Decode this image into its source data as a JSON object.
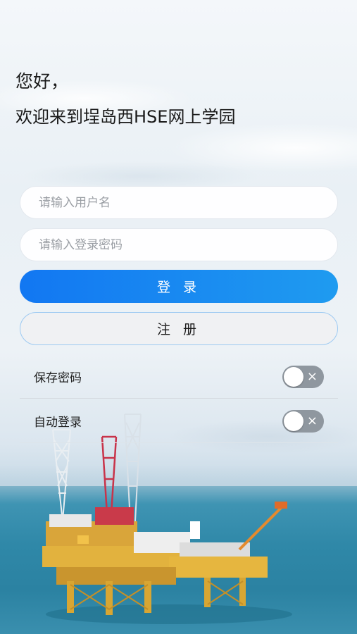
{
  "header": {
    "greeting": "您好，",
    "welcome": "欢迎来到埕岛西HSE网上学园"
  },
  "form": {
    "username_placeholder": "请输入用户名",
    "password_placeholder": "请输入登录密码",
    "login_label": "登 录",
    "register_label": "注 册"
  },
  "options": {
    "save_password_label": "保存密码",
    "save_password_on": false,
    "auto_login_label": "自动登录",
    "auto_login_on": false,
    "toggle_off_glyph": "×"
  },
  "colors": {
    "login_gradient_start": "#1277f2",
    "login_gradient_end": "#1f9bf0",
    "toggle_off": "#8f979f",
    "register_border": "#9dcaf2"
  }
}
